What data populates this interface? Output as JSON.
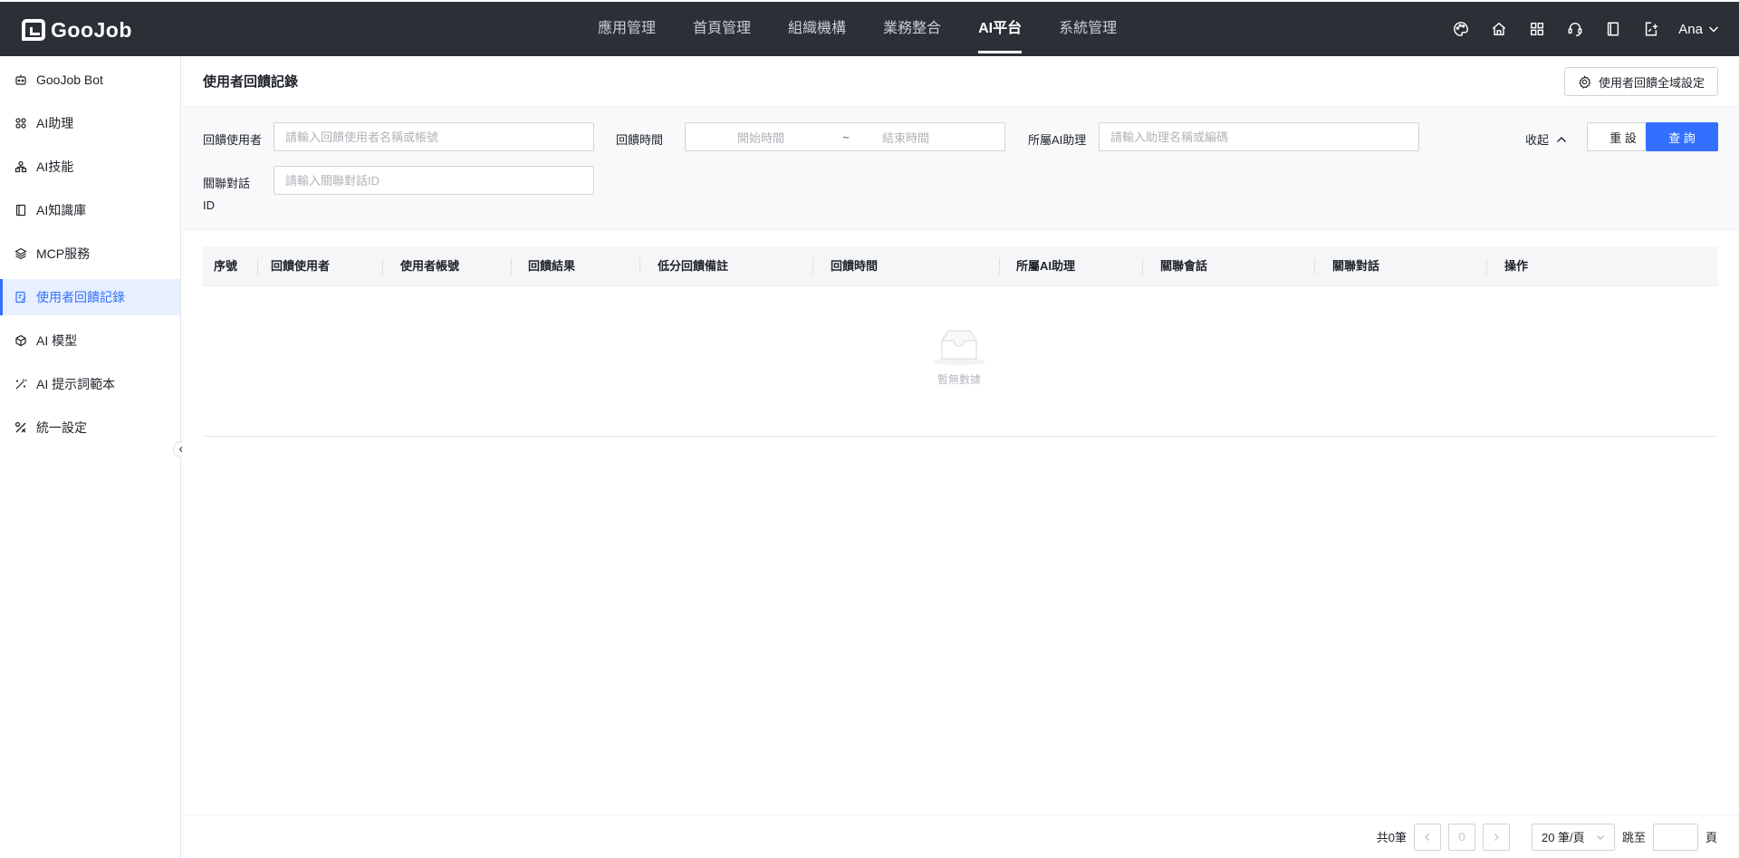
{
  "app": {
    "brand": "GooJob",
    "nav": [
      {
        "label": "應用管理",
        "active": false
      },
      {
        "label": "首頁管理",
        "active": false
      },
      {
        "label": "組織機構",
        "active": false
      },
      {
        "label": "業務整合",
        "active": false
      },
      {
        "label": "AI平台",
        "active": true
      },
      {
        "label": "系統管理",
        "active": false
      }
    ],
    "top_icons": [
      "palette-icon",
      "home-icon",
      "apps-grid-icon",
      "support-headset-icon",
      "book-icon",
      "export-icon"
    ],
    "user_name": "Ana"
  },
  "sidebar": {
    "items": [
      {
        "label": "GooJob Bot",
        "icon": "robot-icon",
        "active": false
      },
      {
        "label": "AI助理",
        "icon": "grid-icon",
        "active": false
      },
      {
        "label": "AI技能",
        "icon": "skill-icon",
        "active": false
      },
      {
        "label": "AI知識庫",
        "icon": "book-icon",
        "active": false
      },
      {
        "label": "MCP服務",
        "icon": "layers-icon",
        "active": false
      },
      {
        "label": "使用者回饋記錄",
        "icon": "feedback-icon",
        "active": true
      },
      {
        "label": "AI 模型",
        "icon": "cube-icon",
        "active": false
      },
      {
        "label": "AI 提示詞範本",
        "icon": "wand-icon",
        "active": false
      },
      {
        "label": "統一設定",
        "icon": "tools-icon",
        "active": false
      }
    ]
  },
  "page": {
    "title": "使用者回饋記錄",
    "global_settings_label": "使用者回饋全域設定"
  },
  "filters": {
    "feedback_user": {
      "label": "回饋使用者",
      "placeholder": "請輸入回饋使用者名稱或帳號"
    },
    "feedback_time": {
      "label": "回饋時間",
      "start_placeholder": "開始時間",
      "separator": "~",
      "end_placeholder": "結束時間"
    },
    "assistant": {
      "label": "所屬AI助理",
      "placeholder": "請輸入助理名稱或編碼"
    },
    "conversation": {
      "label_line1": "關聯對話",
      "label_line2": "ID",
      "placeholder": "請輸入關聯對話ID"
    },
    "collapse_label": "收起",
    "reset_label": "重 設",
    "search_label": "查 詢"
  },
  "table": {
    "columns": [
      "序號",
      "回饋使用者",
      "使用者帳號",
      "回饋結果",
      "低分回饋備註",
      "回饋時間",
      "所屬AI助理",
      "關聯會話",
      "關聯對話",
      "操作"
    ],
    "rows": [],
    "empty_text": "暫無數據"
  },
  "pagination": {
    "total_text": "共0筆",
    "current_page": "0",
    "page_size": "20 筆/頁",
    "jump_label": "跳至",
    "page_suffix": "頁"
  },
  "colors": {
    "topbar": "#2b2f36",
    "accent": "#3370ff",
    "active_bg": "#e8f0ff"
  }
}
